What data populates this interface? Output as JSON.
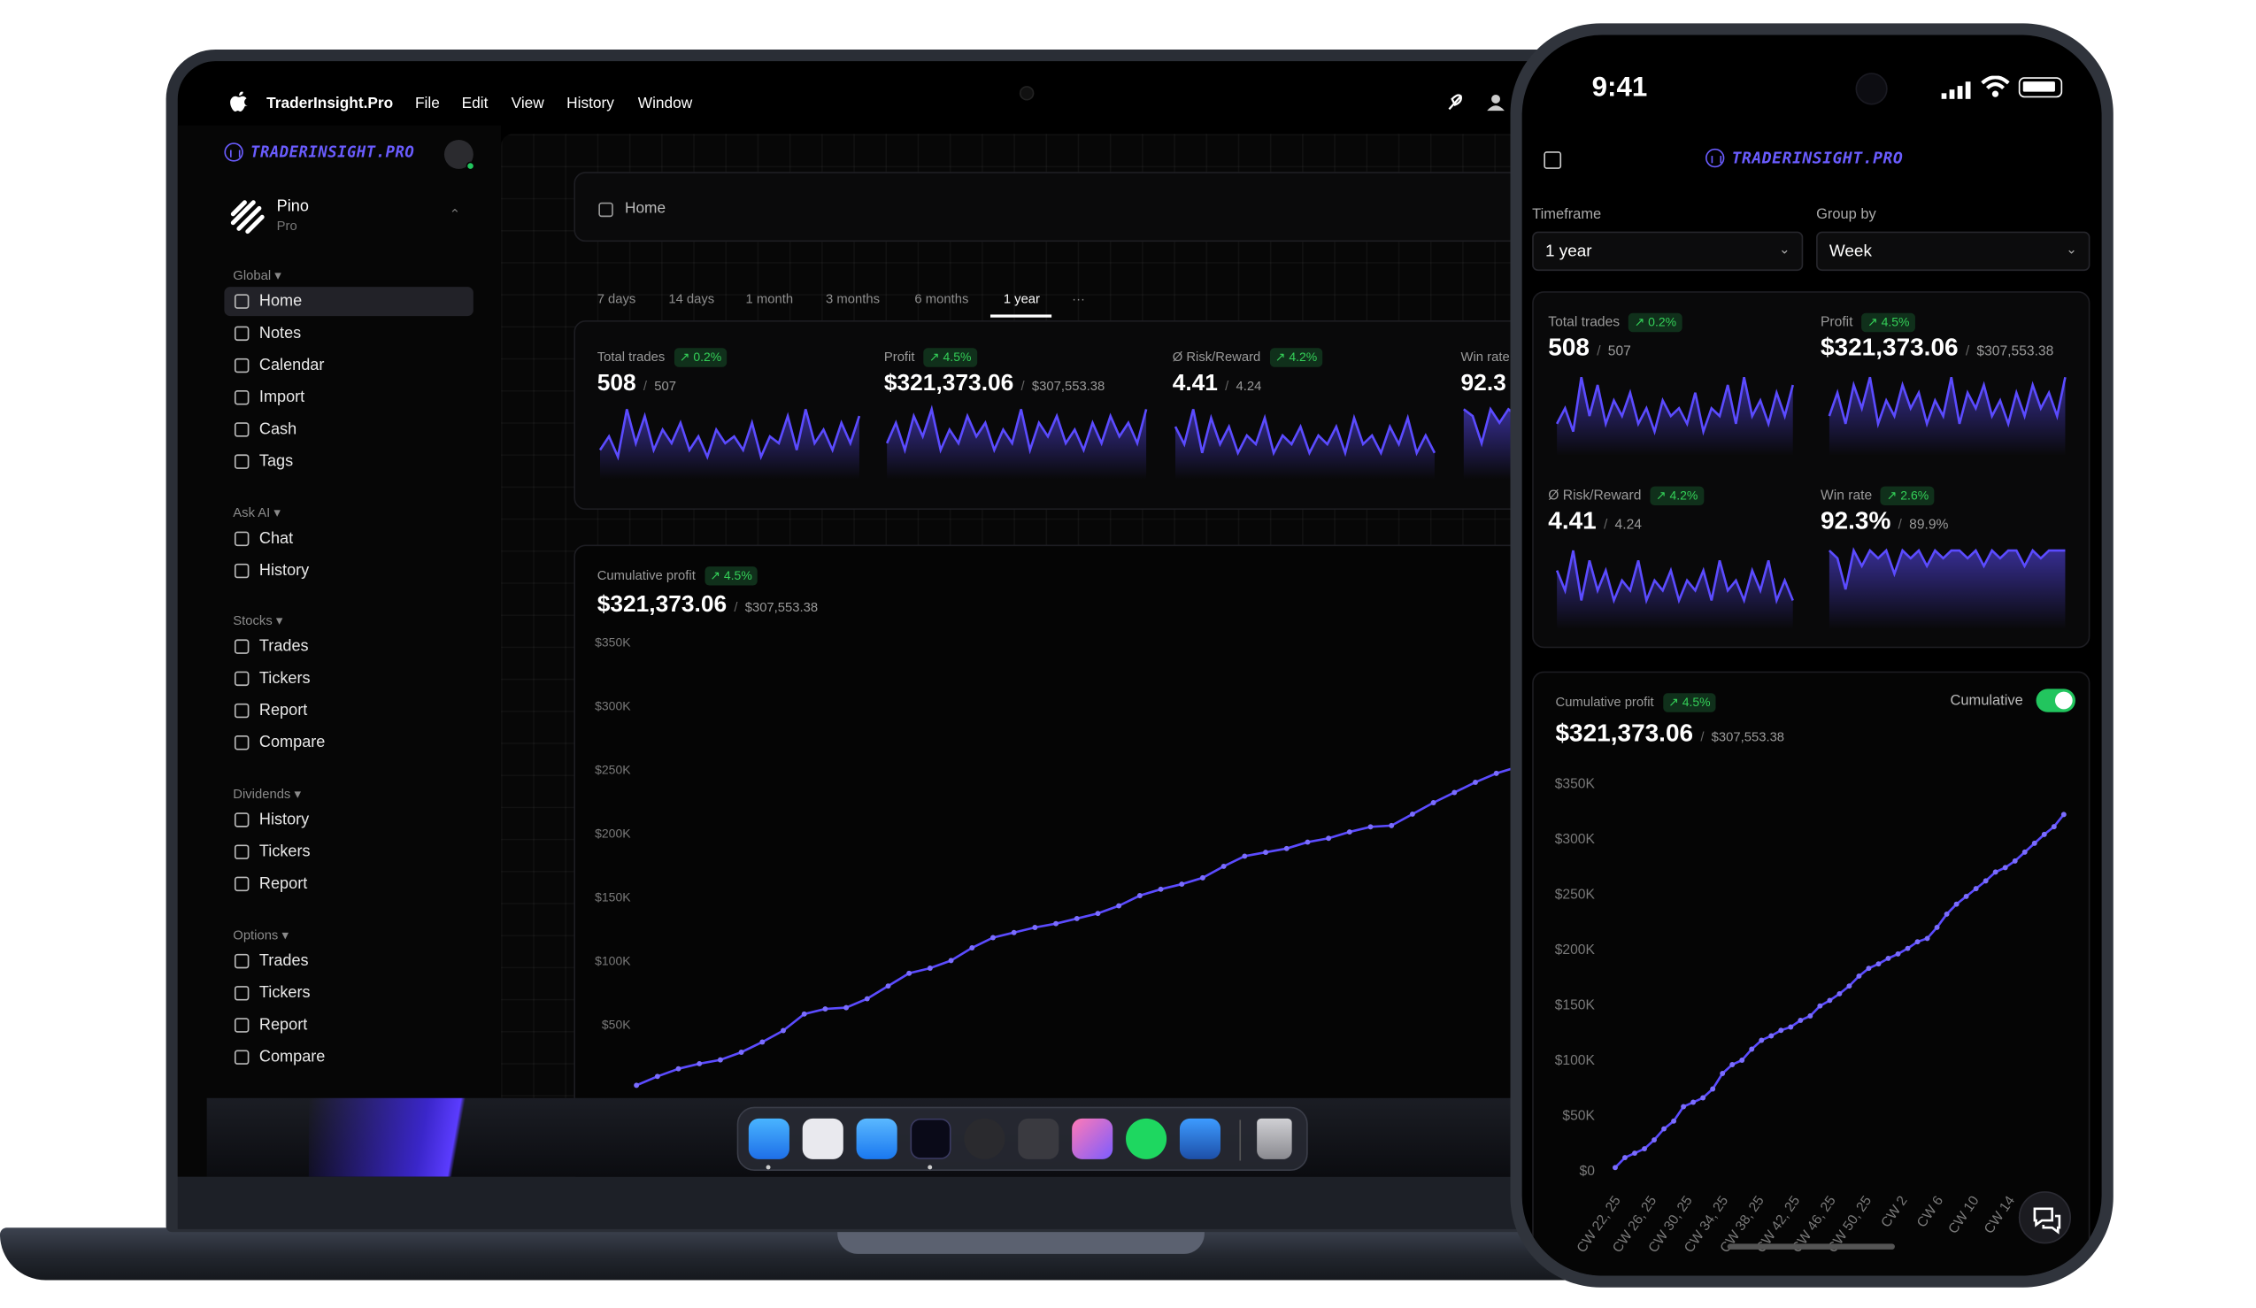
{
  "laptop": {
    "menubar": {
      "app_name": "TraderInsight.Pro",
      "menus": [
        "File",
        "Edit",
        "View",
        "History",
        "Window"
      ]
    },
    "sidebar": {
      "brand": "TRADERINSIGHT.PRO",
      "workspace": {
        "name": "Pino",
        "plan": "Pro"
      },
      "groups": [
        {
          "label": "Global ▾",
          "items": [
            {
              "label": "Home",
              "icon": "grid-icon",
              "active": true
            },
            {
              "label": "Notes",
              "icon": "notes-icon"
            },
            {
              "label": "Calendar",
              "icon": "calendar-icon"
            },
            {
              "label": "Import",
              "icon": "import-icon"
            },
            {
              "label": "Cash",
              "icon": "cash-icon"
            },
            {
              "label": "Tags",
              "icon": "tag-icon"
            }
          ]
        },
        {
          "label": "Ask AI ▾",
          "items": [
            {
              "label": "Chat",
              "icon": "chat-icon"
            },
            {
              "label": "History",
              "icon": "history-icon"
            }
          ]
        },
        {
          "label": "Stocks ▾",
          "items": [
            {
              "label": "Trades",
              "icon": "trades-icon"
            },
            {
              "label": "Tickers",
              "icon": "tickers-icon"
            },
            {
              "label": "Report",
              "icon": "report-icon"
            },
            {
              "label": "Compare",
              "icon": "compare-icon"
            }
          ]
        },
        {
          "label": "Dividends ▾",
          "items": [
            {
              "label": "History",
              "icon": "history-icon"
            },
            {
              "label": "Tickers",
              "icon": "tickers-icon"
            },
            {
              "label": "Report",
              "icon": "report-icon"
            }
          ]
        },
        {
          "label": "Options ▾",
          "items": [
            {
              "label": "Trades",
              "icon": "trades-icon"
            },
            {
              "label": "Tickers",
              "icon": "tickers-icon"
            },
            {
              "label": "Report",
              "icon": "report-icon"
            },
            {
              "label": "Compare",
              "icon": "compare-icon"
            }
          ]
        }
      ]
    },
    "breadcrumb": "Home",
    "tabs": [
      "7 days",
      "14 days",
      "1 month",
      "3 months",
      "6 months",
      "1 year",
      "···"
    ],
    "active_tab": "1 year",
    "kpis": [
      {
        "label": "Total trades",
        "change": "↗ 0.2%",
        "value": "508",
        "previous": "507"
      },
      {
        "label": "Profit",
        "change": "↗ 4.5%",
        "value": "$321,373.06",
        "previous": "$307,553.38"
      },
      {
        "label": "Ø Risk/Reward",
        "change": "↗ 4.2%",
        "value": "4.41",
        "previous": "4.24"
      },
      {
        "label": "Win rate",
        "change": "",
        "value": "92.3",
        "previous": ""
      }
    ],
    "cumulative": {
      "label": "Cumulative profit",
      "change": "↗ 4.5%",
      "value": "$321,373.06",
      "previous": "$307,553.38"
    },
    "dock_apps": [
      "Finder",
      "Launchpad",
      "Mail",
      "TraderInsight.Pro",
      "Browser",
      "Box",
      "AI Assistant",
      "Spotify",
      "Database",
      "Trash"
    ]
  },
  "phone": {
    "status": {
      "time": "9:41"
    },
    "brand": "TRADERINSIGHT.PRO",
    "timeframe": {
      "label": "Timeframe",
      "value": "1 year"
    },
    "groupby": {
      "label": "Group by",
      "value": "Week"
    },
    "kpis": [
      {
        "label": "Total trades",
        "change": "↗ 0.2%",
        "value": "508",
        "previous": "507"
      },
      {
        "label": "Profit",
        "change": "↗ 4.5%",
        "value": "$321,373.06",
        "previous": "$307,553.38"
      },
      {
        "label": "Ø Risk/Reward",
        "change": "↗ 4.2%",
        "value": "4.41",
        "previous": "4.24"
      },
      {
        "label": "Win rate",
        "change": "↗ 2.6%",
        "value": "92.3%",
        "previous": "89.9%"
      }
    ],
    "cumulative": {
      "label": "Cumulative profit",
      "change": "↗ 4.5%",
      "value": "$321,373.06",
      "previous": "$307,553.38",
      "toggle_label": "Cumulative",
      "toggle_on": true
    }
  },
  "colors": {
    "accent": "#5b4bff",
    "positive": "#34d058",
    "toggle": "#22c55e"
  },
  "chart_data": [
    {
      "type": "line",
      "title": "Cumulative profit",
      "xlabel": "",
      "ylabel": "",
      "y_ticks": [
        "$50K",
        "$100K",
        "$150K",
        "$200K",
        "$250K",
        "$300K",
        "$350K"
      ],
      "ylim": [
        0,
        350000
      ],
      "grid": false,
      "series": [
        {
          "values": [
            2000,
            9000,
            15000,
            19000,
            22000,
            28000,
            36000,
            45000,
            58000,
            62000,
            63000,
            70000,
            80000,
            90000,
            94000,
            100000,
            110000,
            118000,
            122000,
            126000,
            129000,
            133000,
            137000,
            143000,
            151000,
            156000,
            160000,
            165000,
            174000,
            182000,
            185000,
            188000,
            193000,
            196000,
            201000,
            205000,
            206000,
            215000,
            224000,
            232000,
            240000,
            247000,
            252000,
            256000,
            262000,
            270000
          ]
        }
      ]
    },
    {
      "type": "line",
      "title": "Cumulative profit",
      "xlabel": "",
      "ylabel": "",
      "y_ticks": [
        "$0",
        "$50K",
        "$100K",
        "$150K",
        "$200K",
        "$250K",
        "$300K",
        "$350K"
      ],
      "x_ticks": [
        "CW 22, 25",
        "CW 26, 25",
        "CW 30, 25",
        "CW 34, 25",
        "CW 38, 25",
        "CW 42, 25",
        "CW 46, 25",
        "CW 50, 25",
        "CW 2",
        "CW 6",
        "CW 10",
        "CW 14"
      ],
      "ylim": [
        0,
        350000
      ],
      "grid": false,
      "series": [
        {
          "values": [
            3000,
            12000,
            16000,
            20000,
            28000,
            38000,
            45000,
            58000,
            62000,
            66000,
            74000,
            88000,
            96000,
            100000,
            110000,
            118000,
            122000,
            127000,
            130000,
            136000,
            140000,
            149000,
            154000,
            160000,
            167000,
            176000,
            183000,
            187000,
            192000,
            196000,
            201000,
            207000,
            210000,
            220000,
            232000,
            241000,
            248000,
            255000,
            262000,
            270000,
            274000,
            280000,
            288000,
            296000,
            304000,
            311000,
            322000
          ]
        }
      ]
    },
    {
      "type": "line",
      "title": "KPI sparklines",
      "xlabel": "",
      "ylabel": "",
      "series": [
        {
          "name": "Total trades",
          "values": [
            3,
            5,
            2,
            9,
            4,
            8,
            3,
            6,
            4,
            7,
            3,
            5,
            2,
            6,
            4,
            5,
            3,
            7,
            2,
            5,
            4,
            8,
            3,
            9,
            4,
            6,
            3,
            7,
            4,
            8
          ]
        },
        {
          "name": "Profit",
          "values": [
            4,
            7,
            3,
            8,
            5,
            9,
            3,
            6,
            4,
            8,
            5,
            7,
            3,
            6,
            4,
            9,
            3,
            7,
            5,
            8,
            4,
            6,
            3,
            7,
            4,
            8,
            5,
            7,
            4,
            9
          ]
        },
        {
          "name": "Ø Risk/Reward",
          "values": [
            5,
            3,
            7,
            2,
            6,
            3,
            5,
            2,
            4,
            3,
            6,
            2,
            4,
            3,
            5,
            2,
            4,
            3,
            5,
            2,
            6,
            3,
            4,
            2,
            5,
            3,
            6,
            2,
            4,
            2
          ]
        },
        {
          "name": "Win rate",
          "values": [
            9,
            8,
            4,
            9,
            7,
            9,
            8,
            9,
            6,
            9,
            8,
            9,
            7,
            9,
            8,
            9,
            9,
            8,
            9,
            7,
            9,
            8,
            9,
            9,
            7,
            9,
            8,
            9,
            9,
            9
          ]
        }
      ]
    }
  ]
}
